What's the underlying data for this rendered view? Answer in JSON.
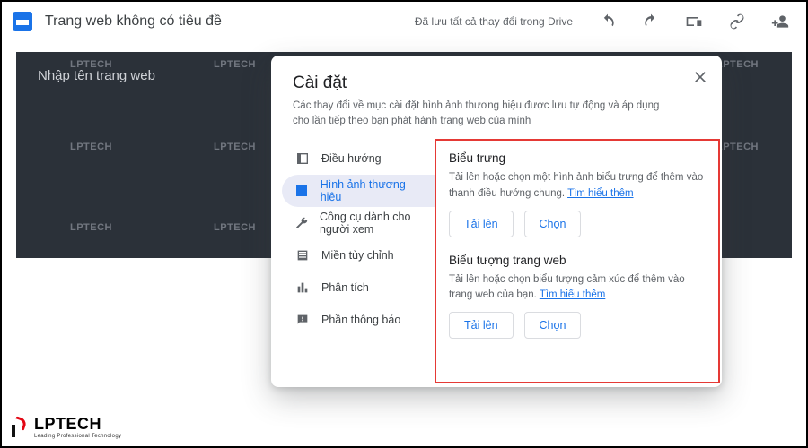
{
  "appbar": {
    "title": "Trang web không có tiêu đề",
    "save_status": "Đã lưu tất cả thay đổi trong Drive"
  },
  "hero": {
    "title_placeholder": "Nhập tên trang web",
    "watermark_text": "LPTECH"
  },
  "modal": {
    "title": "Cài đặt",
    "subtitle": "Các thay đổi về mục cài đặt hình ảnh thương hiệu được lưu tự động và áp dụng cho lần tiếp theo bạn phát hành trang web của mình",
    "nav": {
      "navigation": "Điều hướng",
      "brand_images": "Hình ảnh thương hiệu",
      "viewer_tools": "Công cụ dành cho người xem",
      "custom_domains": "Miền tùy chỉnh",
      "analytics": "Phân tích",
      "announcement": "Phần thông báo"
    },
    "sections": {
      "logo": {
        "title": "Biểu trưng",
        "desc_prefix": "Tải lên hoặc chọn một hình ảnh biểu trưng để thêm vào thanh điều hướng chung. ",
        "learn_more": "Tìm hiểu thêm",
        "upload": "Tải lên",
        "choose": "Chọn"
      },
      "favicon": {
        "title": "Biểu tượng trang web",
        "desc_prefix": "Tải lên hoặc chọn biểu tượng cảm xúc để thêm vào trang web của bạn. ",
        "learn_more": "Tìm hiểu thêm",
        "upload": "Tải lên",
        "choose": "Chọn"
      }
    }
  },
  "brand_corner": {
    "name": "LPTECH",
    "tagline": "Leading Professional Technology"
  }
}
